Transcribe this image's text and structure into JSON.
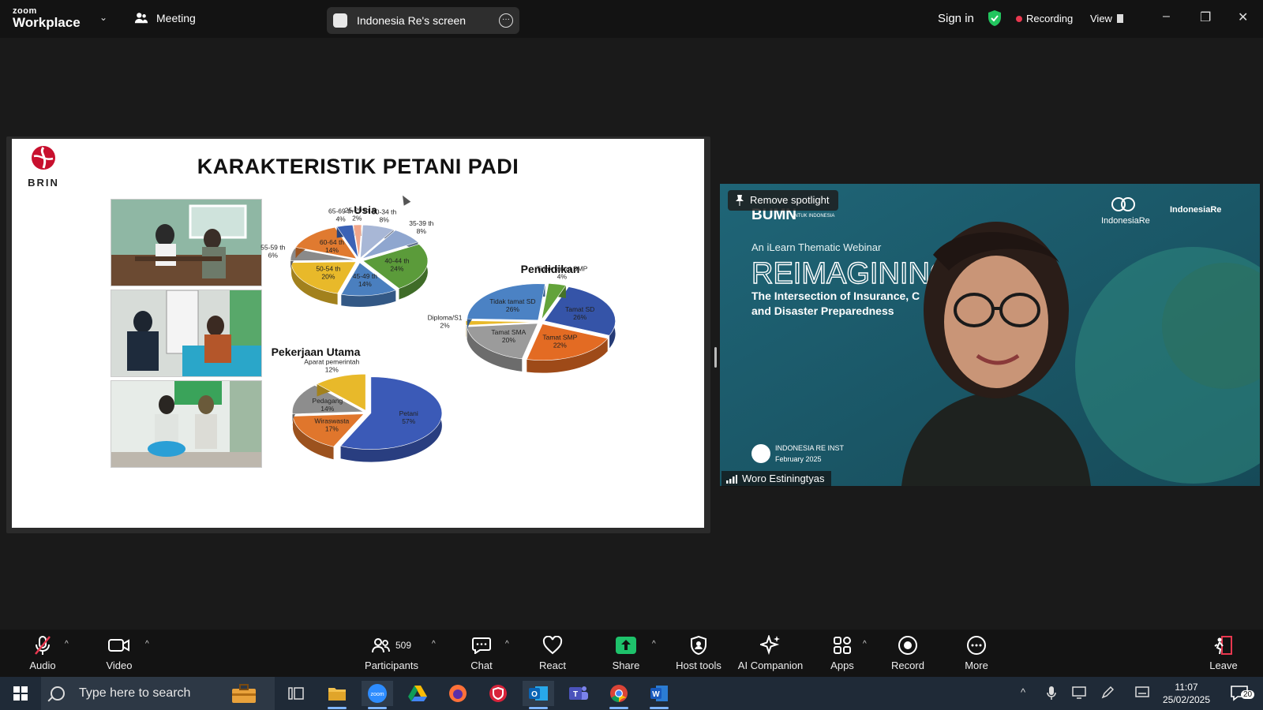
{
  "titlebar": {
    "logo_top": "zoom",
    "logo_bottom": "Workplace",
    "meeting": "Meeting",
    "screen_share": "Indonesia Re's screen",
    "sign_in": "Sign in",
    "recording": "Recording",
    "view": "View"
  },
  "slide": {
    "org": "BRIN",
    "title": "KARAKTERISTIK PETANI PADI"
  },
  "chart_data": [
    {
      "type": "pie",
      "title": "Usia",
      "categories": [
        "25-29 th",
        "30-34 th",
        "35-39 th",
        "40-44 th",
        "45-49 th",
        "50-54 th",
        "55-59 th",
        "60-64 th",
        "65-69 th"
      ],
      "values": [
        2,
        8,
        8,
        24,
        14,
        20,
        6,
        14,
        4
      ],
      "labels": [
        "2%",
        "8%",
        "8%",
        "24%",
        "14%",
        "20%",
        "6%",
        "14%",
        "4%"
      ]
    },
    {
      "type": "pie",
      "title": "Pendidikan",
      "categories": [
        "Tamat SD",
        "Tamat SMP",
        "Tamat SMA",
        "Diploma/S1",
        "Tidak tamat SD",
        "Tidak tamat SMP"
      ],
      "values": [
        26,
        22,
        20,
        2,
        26,
        4
      ],
      "labels": [
        "26%",
        "22%",
        "20%",
        "2%",
        "26%",
        "4%"
      ]
    },
    {
      "type": "pie",
      "title": "Pekerjaan Utama",
      "categories": [
        "Petani",
        "Wiraswasta",
        "Pedagang",
        "Aparat pemerintah"
      ],
      "values": [
        57,
        17,
        14,
        12
      ],
      "labels": [
        "57%",
        "17%",
        "14%",
        "12%"
      ]
    }
  ],
  "video": {
    "remove_spotlight": "Remove spotlight",
    "participant_name": "Woro Estiningtyas",
    "bg_brand": "BUMN",
    "bg_sub": "UNTUK INDONESIA",
    "bg_company": "IndonesiaRe",
    "bg_institute": "IndonesiaRe",
    "bg_webinar": "An iLearn Thematic Webinar",
    "bg_headline": "REIMAGINING",
    "bg_line1": "The Intersection of Insurance, C",
    "bg_line2": "and Disaster Preparedness",
    "bg_footer1": "INDONESIA RE INST",
    "bg_footer2": "February 2025"
  },
  "toolbar": {
    "audio": "Audio",
    "video": "Video",
    "participants": "Participants",
    "participants_count": "509",
    "chat": "Chat",
    "react": "React",
    "share": "Share",
    "host_tools": "Host tools",
    "ai_companion": "AI Companion",
    "apps": "Apps",
    "record": "Record",
    "more": "More",
    "leave": "Leave"
  },
  "taskbar": {
    "search_placeholder": "Type here to search",
    "time": "11:07",
    "date": "25/02/2025",
    "notifications": "20"
  },
  "colors": {
    "accent_green": "#22c55e",
    "recording_red": "#e8384f",
    "share_green": "#1ec26b",
    "leave_red": "#e8384f"
  }
}
